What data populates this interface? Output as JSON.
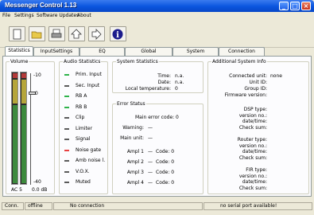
{
  "window": {
    "title": "Messenger Control 1.13"
  },
  "menu": [
    "File",
    "Settings",
    "Software Updates",
    "About"
  ],
  "toolbar": {
    "icons": [
      "new-document-icon",
      "open-folder-icon",
      "print-icon",
      "upload-icon",
      "download-icon",
      "info-icon"
    ]
  },
  "tabs": [
    "Statistics",
    "InputSettings",
    "EQ",
    "Global",
    "System",
    "Connection"
  ],
  "active_tab": "Statistics",
  "volume": {
    "title": "Volume",
    "scale_top": "-10",
    "scale_mid": "0",
    "scale_bottom": "-40",
    "channel_label": "AC 5",
    "level_label": "0.0 dB"
  },
  "audio_statistics": {
    "title": "Audio Statistics",
    "items": [
      {
        "label": "Prim. Input",
        "color": "#2fb34a"
      },
      {
        "label": "Sec. Input",
        "color": "#5a5a5a"
      },
      {
        "label": "RB A",
        "color": "#2fb34a"
      },
      {
        "label": "RB B",
        "color": "#2fb34a"
      },
      {
        "label": "Clip",
        "color": "#5a5a5a"
      },
      {
        "label": "Limiter",
        "color": "#5a5a5a"
      },
      {
        "label": "Signal",
        "color": "#5a5a5a"
      },
      {
        "label": "Noise gate",
        "color": "#e84040"
      },
      {
        "label": "Amb noise l.",
        "color": "#5a5a5a"
      },
      {
        "label": "V.O.X.",
        "color": "#5a5a5a"
      },
      {
        "label": "Muted",
        "color": "#5a5a5a"
      }
    ]
  },
  "system_statistics": {
    "title": "System Statistics",
    "time_label": "Time:",
    "time_value": "n.a.",
    "date_label": "Date:",
    "date_value": "n.a.",
    "temp_label": "Local temperature:",
    "temp_value": "0"
  },
  "error_status": {
    "title": "Error Status",
    "main_error": "Main error code: 0",
    "warning_label": "Warning:",
    "warning_value": "—",
    "main_unit_label": "Main unit:",
    "main_unit_value": "—",
    "ampls": [
      {
        "label": "Ampl 1",
        "code": "Code: 0"
      },
      {
        "label": "Ampl 2",
        "code": "Code: 0"
      },
      {
        "label": "Ampl 3",
        "code": "Code: 0"
      },
      {
        "label": "Ampl 4",
        "code": "Code: 0"
      }
    ]
  },
  "additional_info": {
    "title": "Additional System Info",
    "connected_label": "Connected unit:",
    "connected_value": "none",
    "unit_id": "Unit ID:",
    "group_id": "Group ID:",
    "firmware": "Firmware version:",
    "dsp": [
      "DSP type:",
      "version no.:",
      "date/time:",
      "Check sum:"
    ],
    "router": [
      "Router type:",
      "version no.:",
      "date/time:",
      "Check sum:"
    ],
    "fir": [
      "FIR type:",
      "version no.:",
      "date/time:",
      "Check sum:"
    ]
  },
  "status": {
    "conn": "Conn.",
    "mode": "offline",
    "connection": "No connection",
    "serial": "no serial port available!"
  }
}
